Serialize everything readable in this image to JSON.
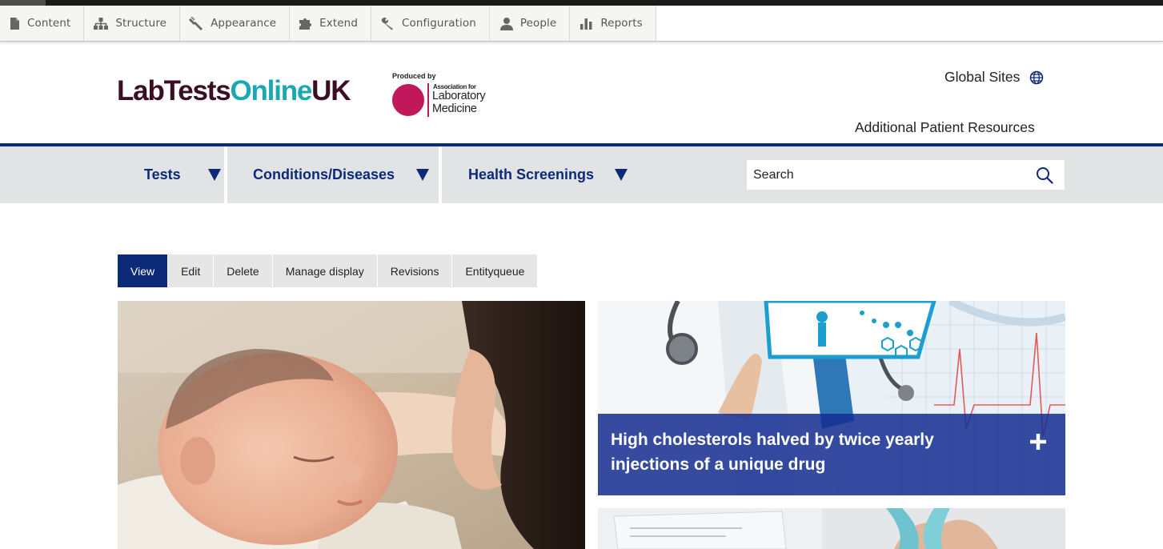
{
  "toolbar": {
    "items": [
      {
        "label": "Content",
        "icon": "file-icon"
      },
      {
        "label": "Structure",
        "icon": "sitemap-icon"
      },
      {
        "label": "Appearance",
        "icon": "brush-icon"
      },
      {
        "label": "Extend",
        "icon": "puzzle-icon"
      },
      {
        "label": "Configuration",
        "icon": "wrench-icon"
      },
      {
        "label": "People",
        "icon": "person-icon"
      },
      {
        "label": "Reports",
        "icon": "bar-chart-icon"
      }
    ]
  },
  "header": {
    "logo_part1": "LabTests",
    "logo_part2": "Online",
    "logo_part3": "UK",
    "produced_by": "Produced by",
    "assoc_small": "Association for",
    "assoc_line1": "Laboratory",
    "assoc_line2": "Medicine",
    "global_sites": "Global Sites",
    "patient_resources": "Additional Patient Resources"
  },
  "nav": {
    "items": [
      {
        "label": "Tests"
      },
      {
        "label": "Conditions/Diseases"
      },
      {
        "label": "Health Screenings"
      }
    ],
    "search_placeholder": "Search"
  },
  "tasks": {
    "items": [
      {
        "label": "View",
        "active": true
      },
      {
        "label": "Edit",
        "active": false
      },
      {
        "label": "Delete",
        "active": false
      },
      {
        "label": "Manage display",
        "active": false
      },
      {
        "label": "Revisions",
        "active": false
      },
      {
        "label": "Entityqueue",
        "active": false
      }
    ]
  },
  "cards": {
    "card1_title": "High cholesterols halved by twice yearly injections of a unique drug"
  },
  "colors": {
    "brand_navy": "#0c2a78",
    "logo_dark": "#3a0f24",
    "logo_teal": "#1aa8b4",
    "assoc_magenta": "#c0185a",
    "caption_blue": "#142d91"
  }
}
